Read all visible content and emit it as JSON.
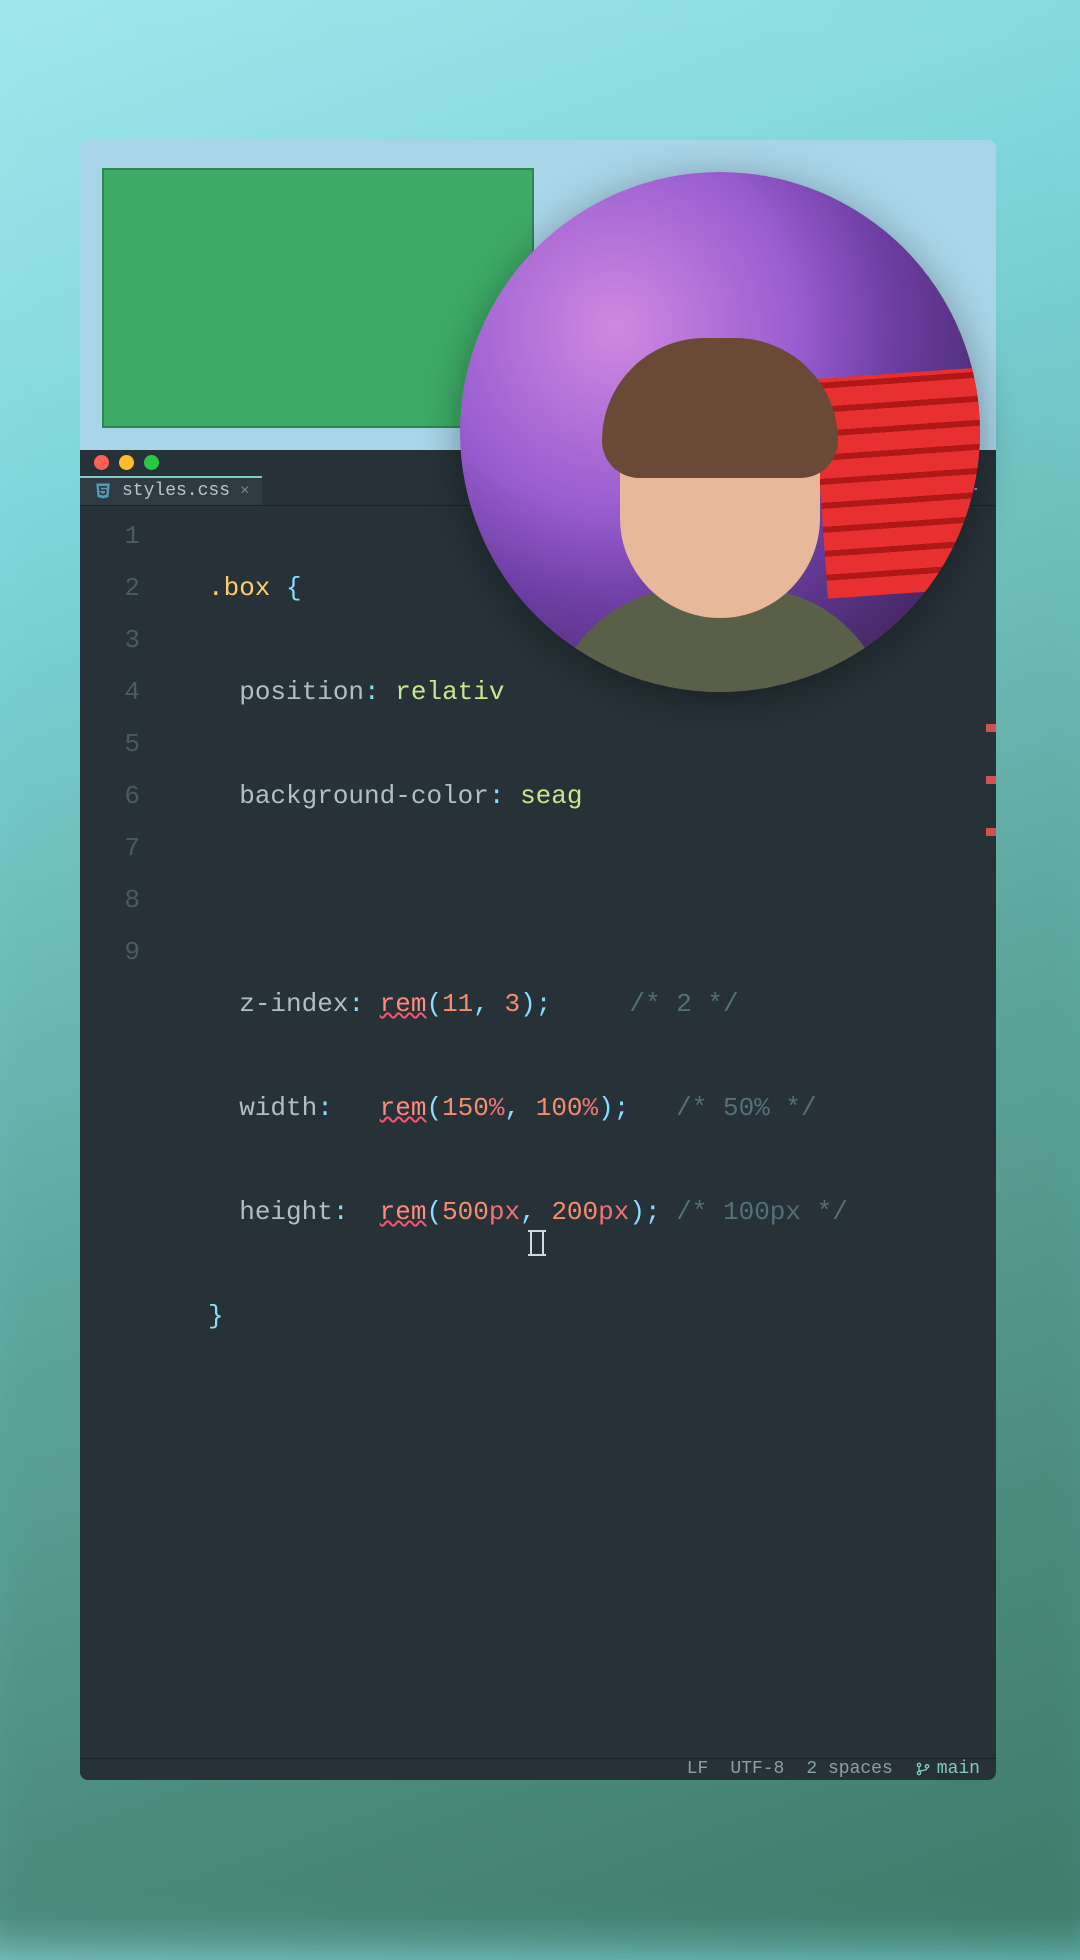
{
  "tab": {
    "filename": "styles.css",
    "close_glyph": "×"
  },
  "nav": {
    "up": "↑",
    "down": "↓",
    "more": "⋮"
  },
  "gutter": [
    "1",
    "2",
    "3",
    "4",
    "5",
    "6",
    "7",
    "8",
    "9"
  ],
  "code": {
    "l1": {
      "selector": ".box",
      "brace": " {"
    },
    "l2": {
      "prop": "position",
      "colon": ": ",
      "val": "relativ",
      "semi": ""
    },
    "l3": {
      "prop": "background-color",
      "colon": ": ",
      "val": "seag",
      "semi": ""
    },
    "l5": {
      "prop": "z-index",
      "colon": ": ",
      "fn": "rem",
      "open": "(",
      "a": "11",
      "comma": ", ",
      "b": "3",
      "close": ")",
      "semi": ";",
      "pad": "     ",
      "comment": "/* 2 */"
    },
    "l6": {
      "prop": "width",
      "colon": ":   ",
      "fn": "rem",
      "open": "(",
      "a": "150",
      "au": "%",
      "comma": ", ",
      "b": "100",
      "bu": "%",
      "close": ")",
      "semi": ";",
      "pad": "   ",
      "comment": "/* 50% */"
    },
    "l7": {
      "prop": "height",
      "colon": ":  ",
      "fn": "rem",
      "open": "(",
      "a": "500",
      "au": "px",
      "comma": ", ",
      "b": "200",
      "bu": "px",
      "close": ")",
      "semi": ";",
      "pad": " ",
      "comment": "/* 100px */"
    },
    "l8": {
      "brace": "}"
    }
  },
  "status": {
    "eol": "LF",
    "encoding": "UTF-8",
    "indent": "2 spaces",
    "branch": "main"
  },
  "colors": {
    "seagreen": "#2e8752"
  }
}
